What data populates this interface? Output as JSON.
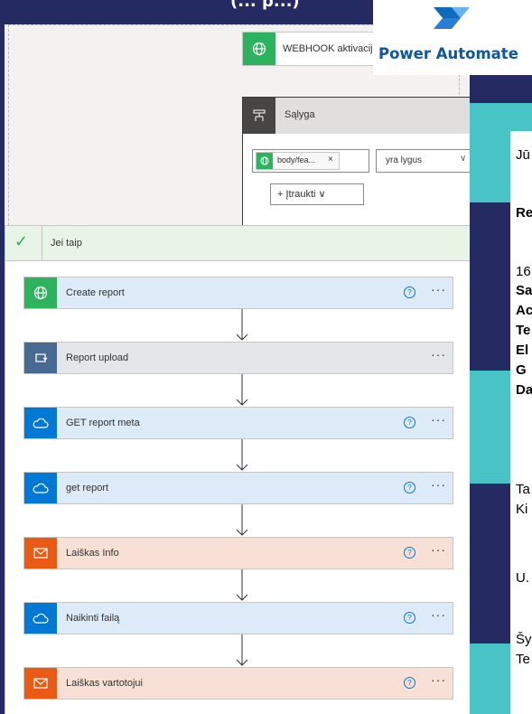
{
  "top_title": "(... p...)",
  "logo": {
    "text": "Power Automate"
  },
  "trigger": {
    "label": "WEBHOOK aktivacija",
    "icon": "globe-icon"
  },
  "condition": {
    "label": "Sąlyga",
    "token_label": "body/fea...",
    "token_close": "×",
    "operator": "yra lygus",
    "insert_label": "Įtraukti"
  },
  "yes_branch": {
    "label": "Jei taip"
  },
  "actions": [
    {
      "label": "Create report",
      "icon": "globe-icon",
      "color": "#2db25e",
      "theme": "blue",
      "help": true
    },
    {
      "label": "Report upload",
      "icon": "loop-icon",
      "color": "#486991",
      "theme": "grey",
      "help": false
    },
    {
      "label": "GET report meta",
      "icon": "onedrive-cloud-icon",
      "color": "#0078d4",
      "theme": "blue",
      "help": true
    },
    {
      "label": "get report",
      "icon": "onedrive-cloud-icon",
      "color": "#0078d4",
      "theme": "blue",
      "help": true
    },
    {
      "label": "Laiškas Info",
      "icon": "mail-icon",
      "color": "#eb5a15",
      "theme": "peach",
      "help": true
    },
    {
      "label": "Naikinti failą",
      "icon": "onedrive-cloud-icon",
      "color": "#0078d4",
      "theme": "blue",
      "help": true
    },
    {
      "label": "Laiškas vartotojui",
      "icon": "mail-icon",
      "color": "#eb5a15",
      "theme": "peach",
      "help": true
    }
  ],
  "doc_lines": [
    {
      "text": "Jū",
      "bold": false
    },
    {
      "text": "Re",
      "bold": true
    },
    {
      "text": "16",
      "bold": false
    },
    {
      "text": "Sa",
      "bold": true
    },
    {
      "text": "Ac",
      "bold": true
    },
    {
      "text": "Te",
      "bold": true
    },
    {
      "text": "El",
      "bold": true
    },
    {
      "text": "G",
      "bold": true
    },
    {
      "text": "Da",
      "bold": true
    },
    {
      "text": "Ta",
      "bold": false
    },
    {
      "text": "Ki",
      "bold": false
    },
    {
      "text": "U.",
      "bold": false
    },
    {
      "text": "Šy",
      "bold": false
    },
    {
      "text": "Te",
      "bold": false
    }
  ]
}
